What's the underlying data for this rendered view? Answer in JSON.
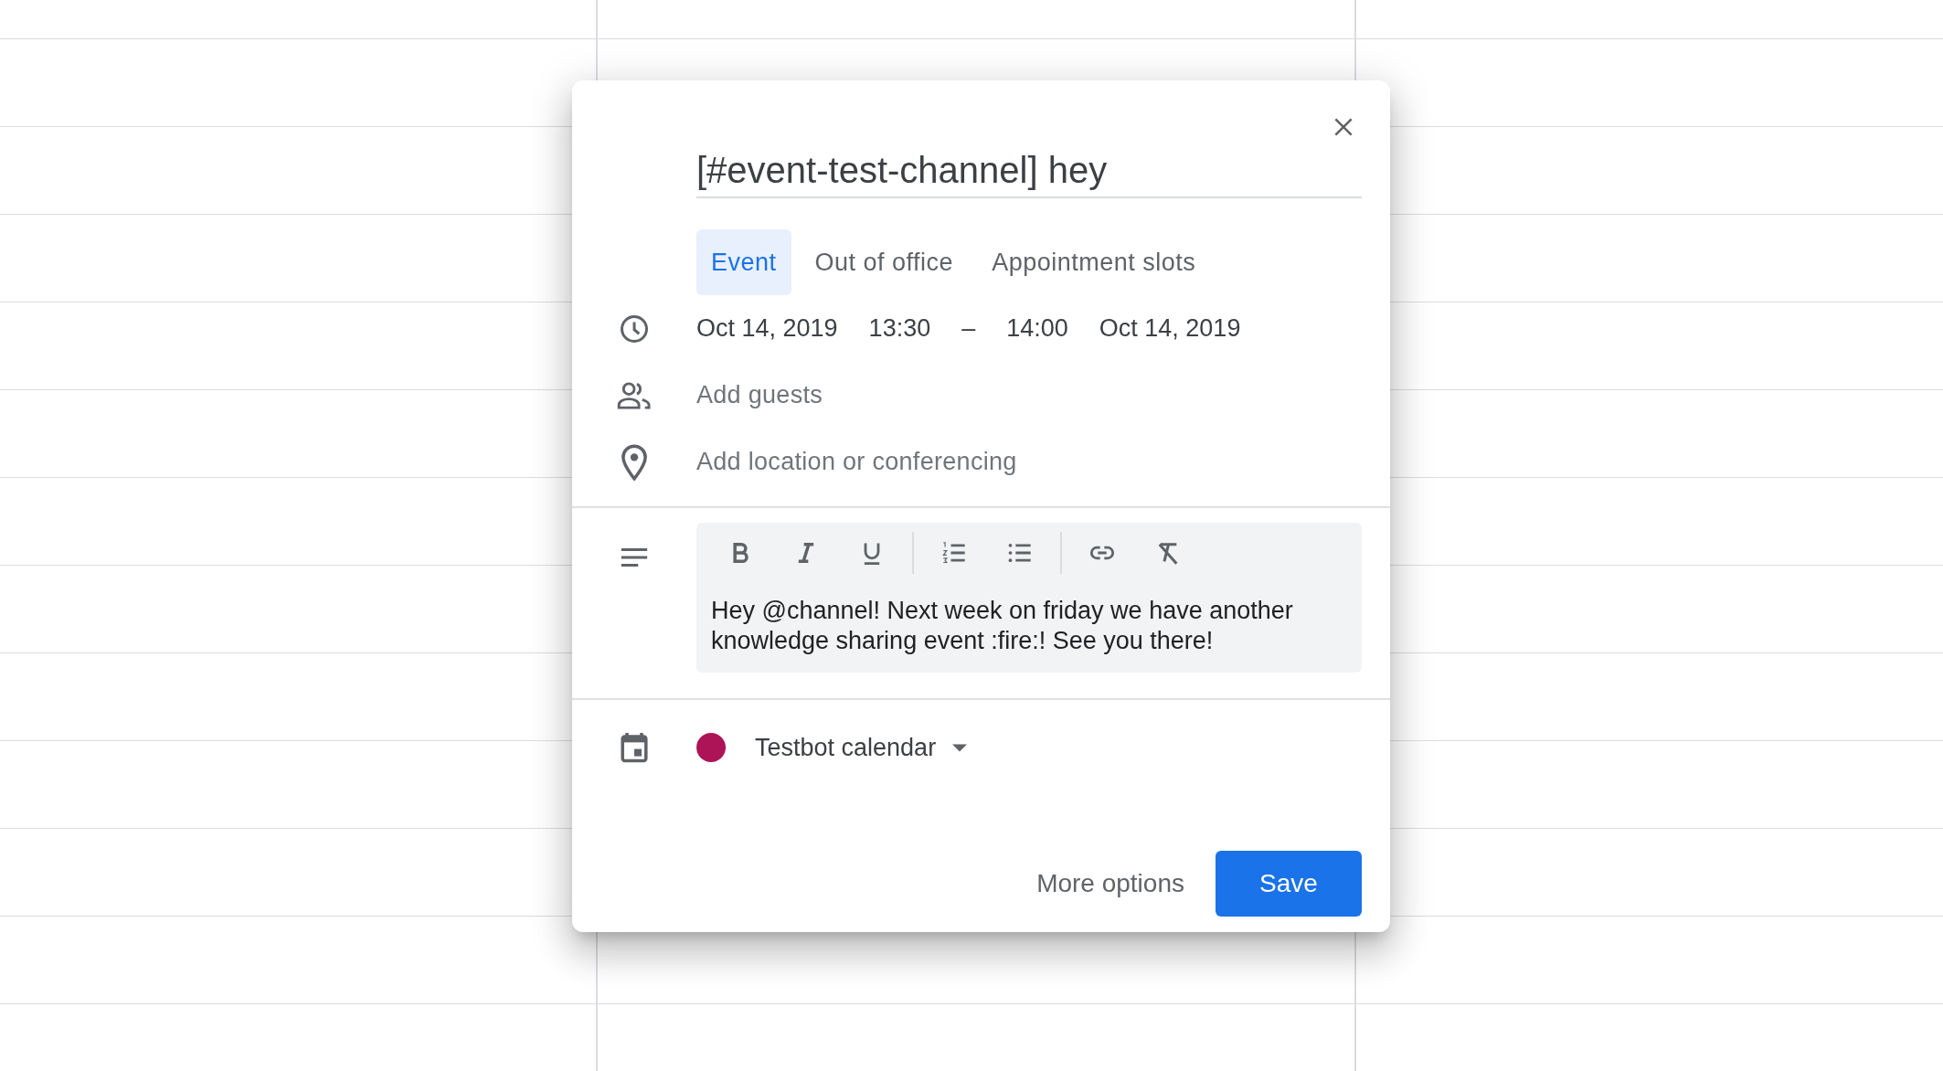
{
  "title": {
    "value": "[#event-test-channel] hey"
  },
  "tabs": [
    {
      "label": "Event",
      "selected": true
    },
    {
      "label": "Out of office",
      "selected": false
    },
    {
      "label": "Appointment slots",
      "selected": false
    }
  ],
  "when": {
    "start_date": "Oct 14, 2019",
    "start_time": "13:30",
    "separator": "–",
    "end_time": "14:00",
    "end_date": "Oct 14, 2019"
  },
  "guests": {
    "placeholder": "Add guests"
  },
  "location": {
    "placeholder": "Add location or conferencing"
  },
  "description": {
    "text": "Hey @channel! Next week on friday we have another knowledge sharing event :fire:! See you there!"
  },
  "calendar": {
    "name": "Testbot calendar",
    "color": "#ad1457"
  },
  "buttons": {
    "more": "More options",
    "save": "Save"
  }
}
